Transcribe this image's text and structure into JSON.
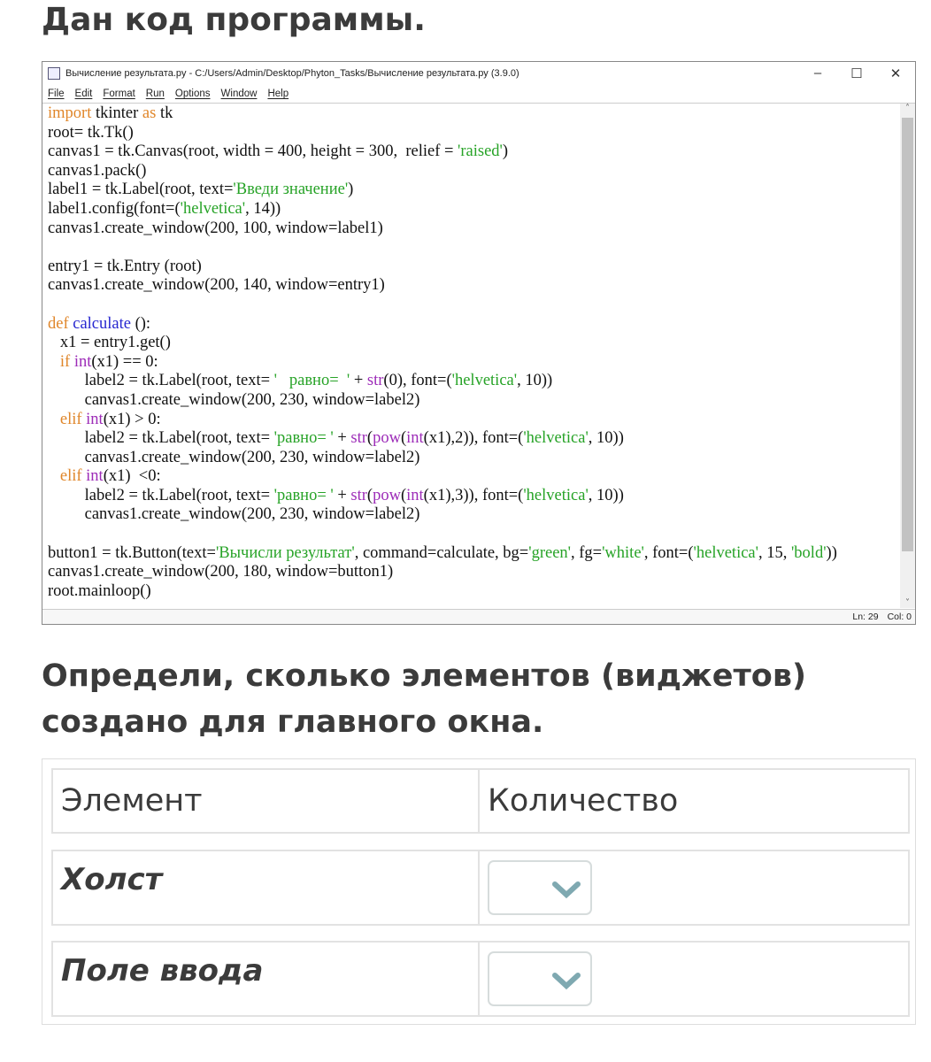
{
  "heading": "Дан код программы.",
  "window": {
    "title": "Вычисление результата.py - C:/Users/Admin/Desktop/Phyton_Tasks/Вычисление результата.py (3.9.0)",
    "controls": [
      "–",
      "☐",
      "✕"
    ],
    "menu": [
      "File",
      "Edit",
      "Format",
      "Run",
      "Options",
      "Window",
      "Help"
    ],
    "status": {
      "ln": "Ln: 29",
      "col": "Col: 0"
    },
    "code": [
      [
        [
          "import",
          "k"
        ],
        [
          " tkinter ",
          ""
        ],
        [
          "as",
          "k"
        ],
        [
          " tk",
          ""
        ]
      ],
      [
        [
          "root= tk.Tk()",
          ""
        ]
      ],
      [
        [
          "canvas1 = tk.Canvas(root, width = 400, height = 300,  relief = ",
          ""
        ],
        [
          "'raised'",
          "s"
        ],
        [
          ")",
          ""
        ]
      ],
      [
        [
          "canvas1.pack()",
          ""
        ]
      ],
      [
        [
          "label1 = tk.Label(root, text=",
          ""
        ],
        [
          "'Введи значение'",
          "s"
        ],
        [
          ")",
          ""
        ]
      ],
      [
        [
          "label1.config(font=(",
          ""
        ],
        [
          "'helvetica'",
          "s"
        ],
        [
          ", 14))",
          ""
        ]
      ],
      [
        [
          "canvas1.create_window(200, 100, window=label1)",
          ""
        ]
      ],
      [
        [
          "",
          ""
        ]
      ],
      [
        [
          "entry1 = tk.Entry (root)",
          ""
        ]
      ],
      [
        [
          "canvas1.create_window(200, 140, window=entry1)",
          ""
        ]
      ],
      [
        [
          "",
          ""
        ]
      ],
      [
        [
          "def",
          "k"
        ],
        [
          " ",
          ""
        ],
        [
          "calculate",
          "d"
        ],
        [
          " ():",
          ""
        ]
      ],
      [
        [
          "   x1 = entry1.get()",
          ""
        ]
      ],
      [
        [
          "   ",
          ""
        ],
        [
          "if",
          "k"
        ],
        [
          " ",
          ""
        ],
        [
          "int",
          "b"
        ],
        [
          "(x1) == 0:",
          ""
        ]
      ],
      [
        [
          "         label2 = tk.Label(root, text= ",
          ""
        ],
        [
          "'   равно=  '",
          "s"
        ],
        [
          " + ",
          ""
        ],
        [
          "str",
          "b"
        ],
        [
          "(0), font=(",
          ""
        ],
        [
          "'helvetica'",
          "s"
        ],
        [
          ", 10))",
          ""
        ]
      ],
      [
        [
          "         canvas1.create_window(200, 230, window=label2)",
          ""
        ]
      ],
      [
        [
          "   ",
          ""
        ],
        [
          "elif",
          "k"
        ],
        [
          " ",
          ""
        ],
        [
          "int",
          "b"
        ],
        [
          "(x1) > 0:",
          ""
        ]
      ],
      [
        [
          "         label2 = tk.Label(root, text= ",
          ""
        ],
        [
          "'равно= '",
          "s"
        ],
        [
          " + ",
          ""
        ],
        [
          "str",
          "b"
        ],
        [
          "(",
          ""
        ],
        [
          "pow",
          "b"
        ],
        [
          "(",
          ""
        ],
        [
          "int",
          "b"
        ],
        [
          "(x1),2)), font=(",
          ""
        ],
        [
          "'helvetica'",
          "s"
        ],
        [
          ", 10))",
          ""
        ]
      ],
      [
        [
          "         canvas1.create_window(200, 230, window=label2)",
          ""
        ]
      ],
      [
        [
          "   ",
          ""
        ],
        [
          "elif",
          "k"
        ],
        [
          " ",
          ""
        ],
        [
          "int",
          "b"
        ],
        [
          "(x1)  <0:",
          ""
        ]
      ],
      [
        [
          "         label2 = tk.Label(root, text= ",
          ""
        ],
        [
          "'равно= '",
          "s"
        ],
        [
          " + ",
          ""
        ],
        [
          "str",
          "b"
        ],
        [
          "(",
          ""
        ],
        [
          "pow",
          "b"
        ],
        [
          "(",
          ""
        ],
        [
          "int",
          "b"
        ],
        [
          "(x1),3)), font=(",
          ""
        ],
        [
          "'helvetica'",
          "s"
        ],
        [
          ", 10))",
          ""
        ]
      ],
      [
        [
          "         canvas1.create_window(200, 230, window=label2)",
          ""
        ]
      ],
      [
        [
          "",
          ""
        ]
      ],
      [
        [
          "button1 = tk.Button(text=",
          ""
        ],
        [
          "'Вычисли результат'",
          "s"
        ],
        [
          ", command=calculate, bg=",
          ""
        ],
        [
          "'green'",
          "s"
        ],
        [
          ", fg=",
          ""
        ],
        [
          "'white'",
          "s"
        ],
        [
          ", font=(",
          ""
        ],
        [
          "'helvetica'",
          "s"
        ],
        [
          ", 15, ",
          ""
        ],
        [
          "'bold'",
          "s"
        ],
        [
          "))",
          ""
        ]
      ],
      [
        [
          "canvas1.create_window(200, 180, window=button1)",
          ""
        ]
      ],
      [
        [
          "root.mainloop()",
          ""
        ]
      ]
    ]
  },
  "question": "Определи, сколько элементов (виджетов) создано для главного окна.",
  "table": {
    "headers": [
      "Элемент",
      "Количество"
    ],
    "rows": [
      {
        "label": "Холст",
        "value": ""
      },
      {
        "label": "Поле ввода",
        "value": ""
      }
    ]
  },
  "colors": {
    "chevron": "#7fa9b1"
  }
}
